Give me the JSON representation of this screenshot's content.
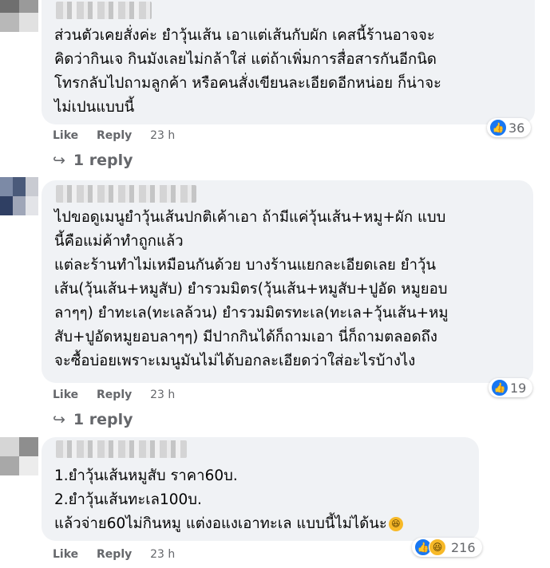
{
  "comments": [
    {
      "lines": [
        "ส่วนตัวเคยสั่งค่ะ ยำวุ้นเส้น เอาแต่เส้นกับผัก เคสนี้ร้านอาจจะ",
        "คิดว่ากินเจ กินมังเลยไม่กล้าใส่ แต่ถ้าเพิ่มการสื่อสารกันอีกนิด",
        "โทรกลับไปถามลูกค้า หรือคนสั่งเขียนละเอียดอีกหน่อย ก็น่าจะ",
        "ไม่เปนแบบนี้"
      ],
      "like_label": "Like",
      "reply_label": "Reply",
      "time": "23 h",
      "reaction_count": "36",
      "replies_label": "1 reply"
    },
    {
      "lines": [
        "ไปขอดูเมนูยำวุ้นเส้นปกติเค้าเอา ถ้ามีแค่วุ้นเส้น+หมู+ผัก แบบ",
        "นี้คือแม่ค้าทำถูกแล้ว",
        "แต่ละร้านทำไม่เหมือนกันด้วย บางร้านแยกละเอียดเลย ยำวุ้น",
        "เส้น(วุ้นเส้น+หมูสับ) ยำรวมมิตร(วุ้นเส้น+หมูสับ+ปูอัด หมูยอบ",
        "ลาๆๆ) ยำทะเล(ทะเลล้วน) ยำรวมมิตรทะเล(ทะเล+วุ้นเส้น+หมู",
        "สับ+ปูอัดหมูยอบลาๆๆ) มีปากกินได้ก็ถามเอา นี่ก็ถามตลอดถึง",
        "จะซื้อบ่อยเพราะเมนูมันไม่ได้บอกละเอียดว่าใส่อะไรบ้างไง"
      ],
      "like_label": "Like",
      "reply_label": "Reply",
      "time": "23 h",
      "reaction_count": "19",
      "replies_label": "1 reply"
    },
    {
      "lines": [
        "1.ยำวุ้นเส้นหมูสับ ราคา60บ.",
        "2.ยำวุ้นเส้นทะเล100บ.",
        "แล้วจ่าย60ไม่กินหมู แต่งอแงเอาทะเล แบบนี้ไม่ได้นะ"
      ],
      "like_label": "Like",
      "reply_label": "Reply",
      "time": "23 h",
      "reaction_count": "216"
    }
  ],
  "icons": {
    "like": "like-reaction-icon",
    "haha": "haha-reaction-icon",
    "reply_arrow": "reply-arrow-icon",
    "laugh_emoji": "laughing-emoji-icon"
  },
  "colors": {
    "bubble": "#f0f2f5",
    "meta_text": "#65676b",
    "like_blue": "#1877f2",
    "haha_yellow": "#f7b928"
  }
}
